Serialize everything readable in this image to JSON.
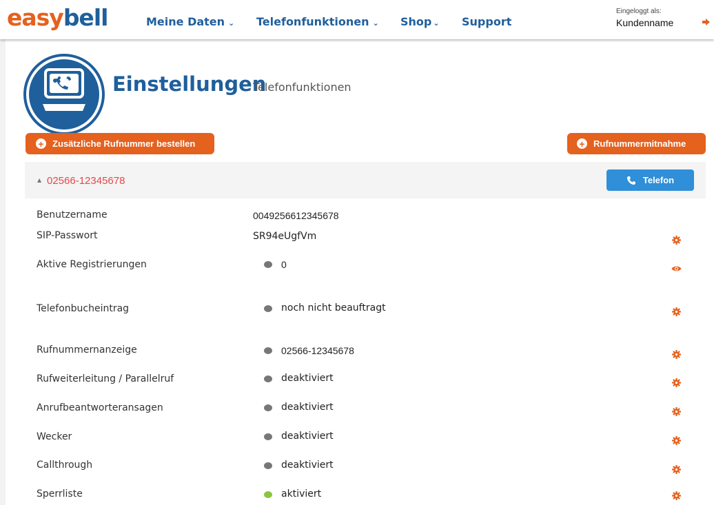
{
  "logo": {
    "part1": "easy",
    "part2": "bell"
  },
  "nav": [
    {
      "label": "Meine Daten",
      "caret": "⌄"
    },
    {
      "label": "Telefonfunktionen",
      "caret": "⌄"
    },
    {
      "label": "Shop",
      "caret": "⌄"
    },
    {
      "label": "Support"
    }
  ],
  "login": {
    "label": "Eingeloggt als:",
    "name": "Kundenname",
    "logout_icon": "logout-icon"
  },
  "page": {
    "title": "Einstellungen",
    "subtitle": "Telefonfunktionen",
    "hero_icon": "monitor-phone-icon"
  },
  "buttons": {
    "order_number": "Zusätzliche Rufnummer bestellen",
    "porting": "Rufnummermitnahme",
    "phone": "Telefon"
  },
  "panel": {
    "number": "02566-12345678"
  },
  "rows": [
    {
      "label": "Benutzername",
      "value": "0049256612345678",
      "status": "none",
      "action": "none"
    },
    {
      "label": "SIP-Passwort",
      "value": "SR94eUgfVm",
      "status": "none",
      "action": "gear"
    },
    {
      "label": "Aktive Registrierungen",
      "value": "0",
      "status": "gray",
      "action": "eye"
    },
    {
      "label": "Telefonbucheintrag",
      "value": "noch nicht beauftragt",
      "status": "gray",
      "action": "gear"
    },
    {
      "label": "Rufnummernanzeige",
      "value": "02566-12345678",
      "status": "gray",
      "action": "gear"
    },
    {
      "label": "Rufweiterleitung / Parallelruf",
      "value": "deaktiviert",
      "status": "gray",
      "action": "gear"
    },
    {
      "label": "Anrufbeantworteransagen",
      "value": "deaktiviert",
      "status": "gray",
      "action": "gear"
    },
    {
      "label": "Wecker",
      "value": "deaktiviert",
      "status": "gray",
      "action": "gear"
    },
    {
      "label": "Callthrough",
      "value": "deaktiviert",
      "status": "gray",
      "action": "gear"
    },
    {
      "label": "Sperrliste",
      "value": "aktiviert",
      "status": "green",
      "action": "gear"
    }
  ],
  "colors": {
    "brand_blue": "#1f5f9c",
    "brand_orange": "#e4611e",
    "button_blue": "#2f8fd8",
    "number_red": "#e5474a",
    "status_gray": "#777777",
    "status_green": "#8cc63f"
  }
}
